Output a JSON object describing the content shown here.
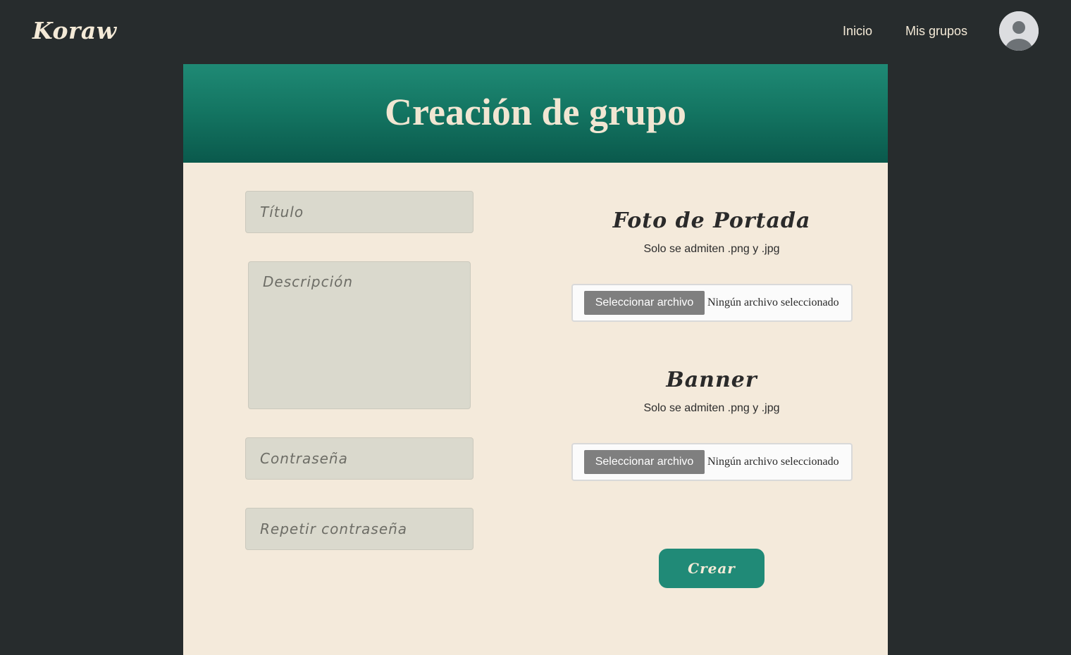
{
  "navbar": {
    "logo": "Koraw",
    "links": [
      {
        "label": "Inicio"
      },
      {
        "label": "Mis grupos"
      }
    ],
    "avatar_icon": "user-avatar-icon"
  },
  "page": {
    "title": "Creación de grupo"
  },
  "form": {
    "titulo_placeholder": "Título",
    "descripcion_placeholder": "Descripción",
    "contrasena_placeholder": "Contraseña",
    "repetir_placeholder": "Repetir contraseña"
  },
  "foto_portada": {
    "title": "Foto de Portada",
    "note": "Solo se admiten .png y .jpg",
    "button_label": "Seleccionar archivo",
    "status": "Ningún archivo seleccionado"
  },
  "banner": {
    "title": "Banner",
    "note": "Solo se admiten .png y .jpg",
    "button_label": "Seleccionar archivo",
    "status": "Ningún archivo seleccionado"
  },
  "submit": {
    "label": "Crear"
  },
  "colors": {
    "background": "#272c2d",
    "card": "#f4eadb",
    "header_top": "#1f8a75",
    "header_bottom": "#0a594c",
    "accent": "#208a77",
    "input_bg": "#dad9cd"
  }
}
